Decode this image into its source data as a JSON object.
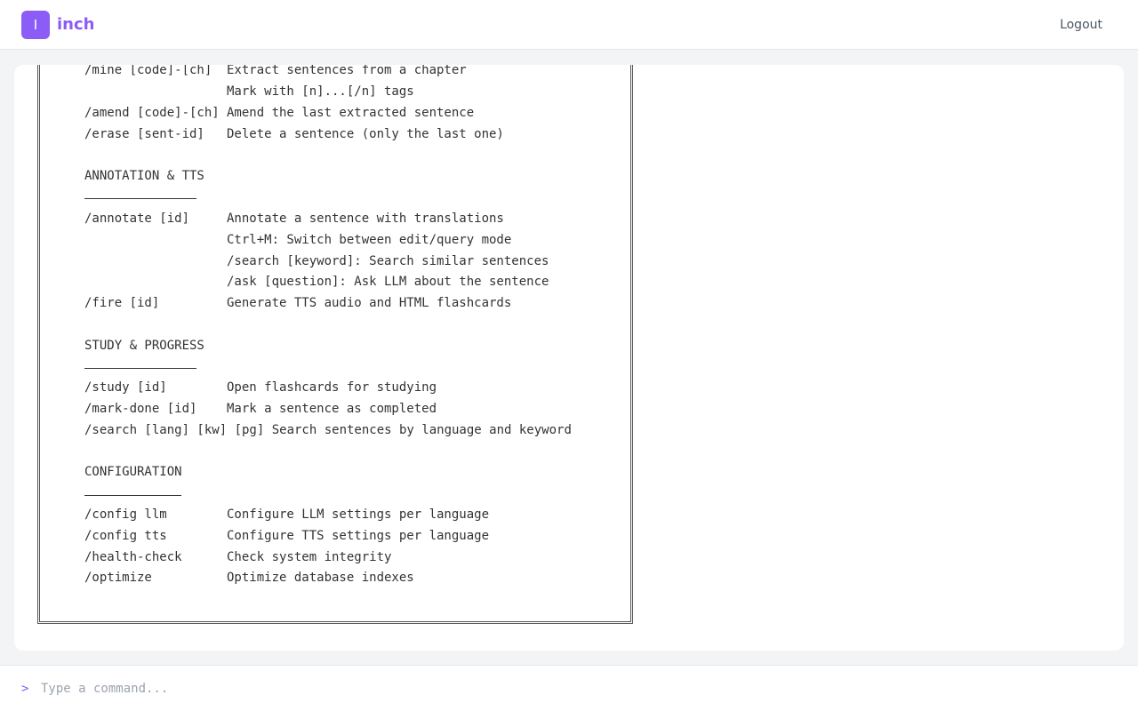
{
  "header": {
    "logo_letter": "I",
    "app_name": "inch",
    "logout_label": "Logout"
  },
  "terminal": {
    "rows": [
      {
        "cmd": "/mine [code]-[ch]",
        "desc": "Extract sentences from a chapter"
      },
      {
        "cmd": "",
        "desc": "Mark with [n]...[/n] tags"
      },
      {
        "cmd": "/amend [code]-[ch]",
        "desc": "Amend the last extracted sentence"
      },
      {
        "cmd": "/erase [sent-id]",
        "desc": "Delete a sentence (only the last one)"
      }
    ],
    "section_annotation": "ANNOTATION & TTS",
    "annotation_rows": [
      {
        "cmd": "/annotate [id]",
        "desc": "Annotate a sentence with translations"
      },
      {
        "cmd": "",
        "desc": "Ctrl+M: Switch between edit/query mode"
      },
      {
        "cmd": "",
        "desc": "/search [keyword]: Search similar sentences"
      },
      {
        "cmd": "",
        "desc": "/ask [question]: Ask LLM about the sentence"
      },
      {
        "cmd": "/fire [id]",
        "desc": "Generate TTS audio and HTML flashcards"
      }
    ],
    "section_study": "STUDY & PROGRESS",
    "study_rows": [
      {
        "cmd": "/study [id]",
        "desc": "Open flashcards for studying"
      },
      {
        "cmd": "/mark-done [id]",
        "desc": "Mark a sentence as completed"
      },
      {
        "full": "/search [lang] [kw] [pg] Search sentences by language and keyword"
      }
    ],
    "section_config": "CONFIGURATION",
    "config_rows": [
      {
        "cmd": "/config llm",
        "desc": "Configure LLM settings per language"
      },
      {
        "cmd": "/config tts",
        "desc": "Configure TTS settings per language"
      },
      {
        "cmd": "/health-check",
        "desc": "Check system integrity"
      },
      {
        "cmd": "/optimize",
        "desc": "Optimize database indexes"
      }
    ]
  },
  "input": {
    "prompt_symbol": ">",
    "placeholder": "Type a command...",
    "value": ""
  },
  "colors": {
    "accent": "#8b5cf6",
    "text": "#333333",
    "background": "#f3f4f6"
  }
}
